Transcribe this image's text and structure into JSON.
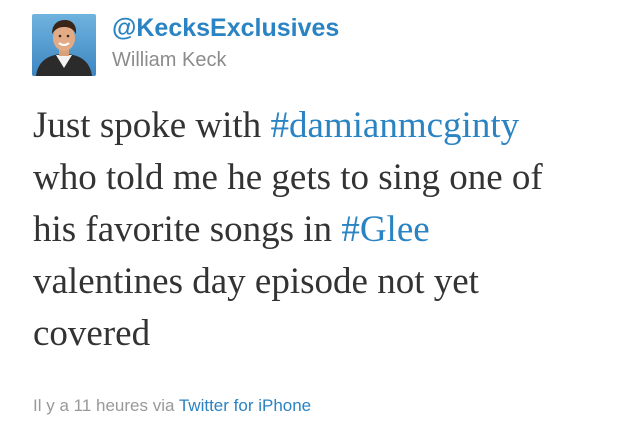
{
  "author": {
    "screen_name": "@KecksExclusives",
    "full_name": "William Keck",
    "avatar": "profile-photo"
  },
  "tweet": {
    "line1_text": "Just spoke with ",
    "hashtag1": "#damianmcginty",
    "line2_text": "who told me he gets to sing one of",
    "line3_text": "his favorite songs in ",
    "hashtag2": "#Glee",
    "line4_text": "valentines day episode not yet",
    "line5_text": "covered"
  },
  "meta": {
    "timestamp": "Il y a 11 heures",
    "via": " via ",
    "source": "Twitter for iPhone"
  },
  "colors": {
    "link": "#2a83c2",
    "text": "#333333",
    "muted": "#999999"
  }
}
